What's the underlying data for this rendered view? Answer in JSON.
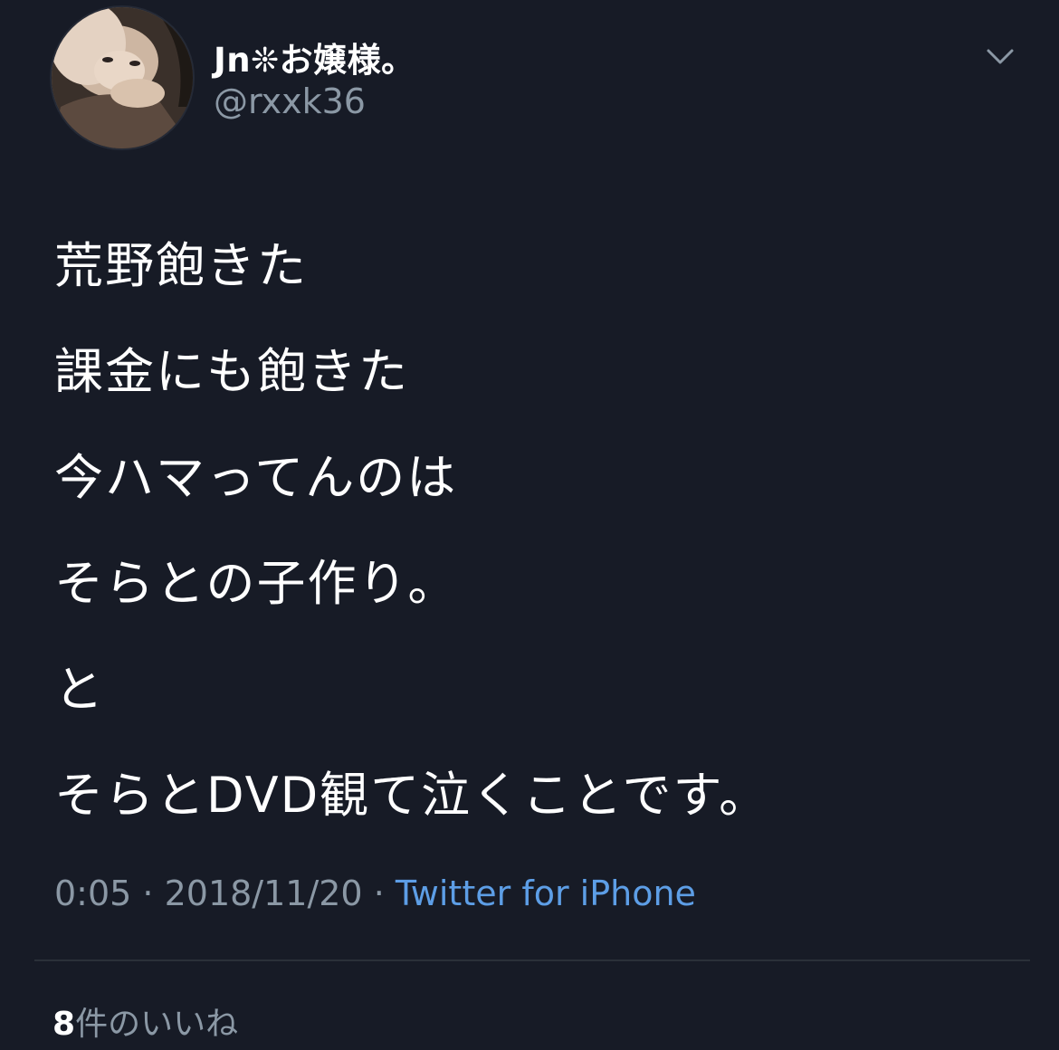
{
  "tweet": {
    "author": {
      "display_name": "Jn❊お嬢様。",
      "handle": "@rxxk36"
    },
    "lines": [
      "荒野飽きた",
      "課金にも飽きた",
      "今ハマってんのは",
      "そらとの子作り。",
      "と",
      "そらとDVD観て泣くことです。"
    ],
    "meta": {
      "time": "0:05",
      "separator": " · ",
      "date": "2018/11/20",
      "source": "Twitter for iPhone"
    },
    "likes": {
      "count": "8",
      "label": "件のいいね"
    },
    "icons": {
      "more": "chevron-down-icon"
    },
    "colors": {
      "background": "#171b26",
      "text": "#ffffff",
      "secondary": "#8b98a5",
      "link": "#5d9ee6"
    }
  }
}
